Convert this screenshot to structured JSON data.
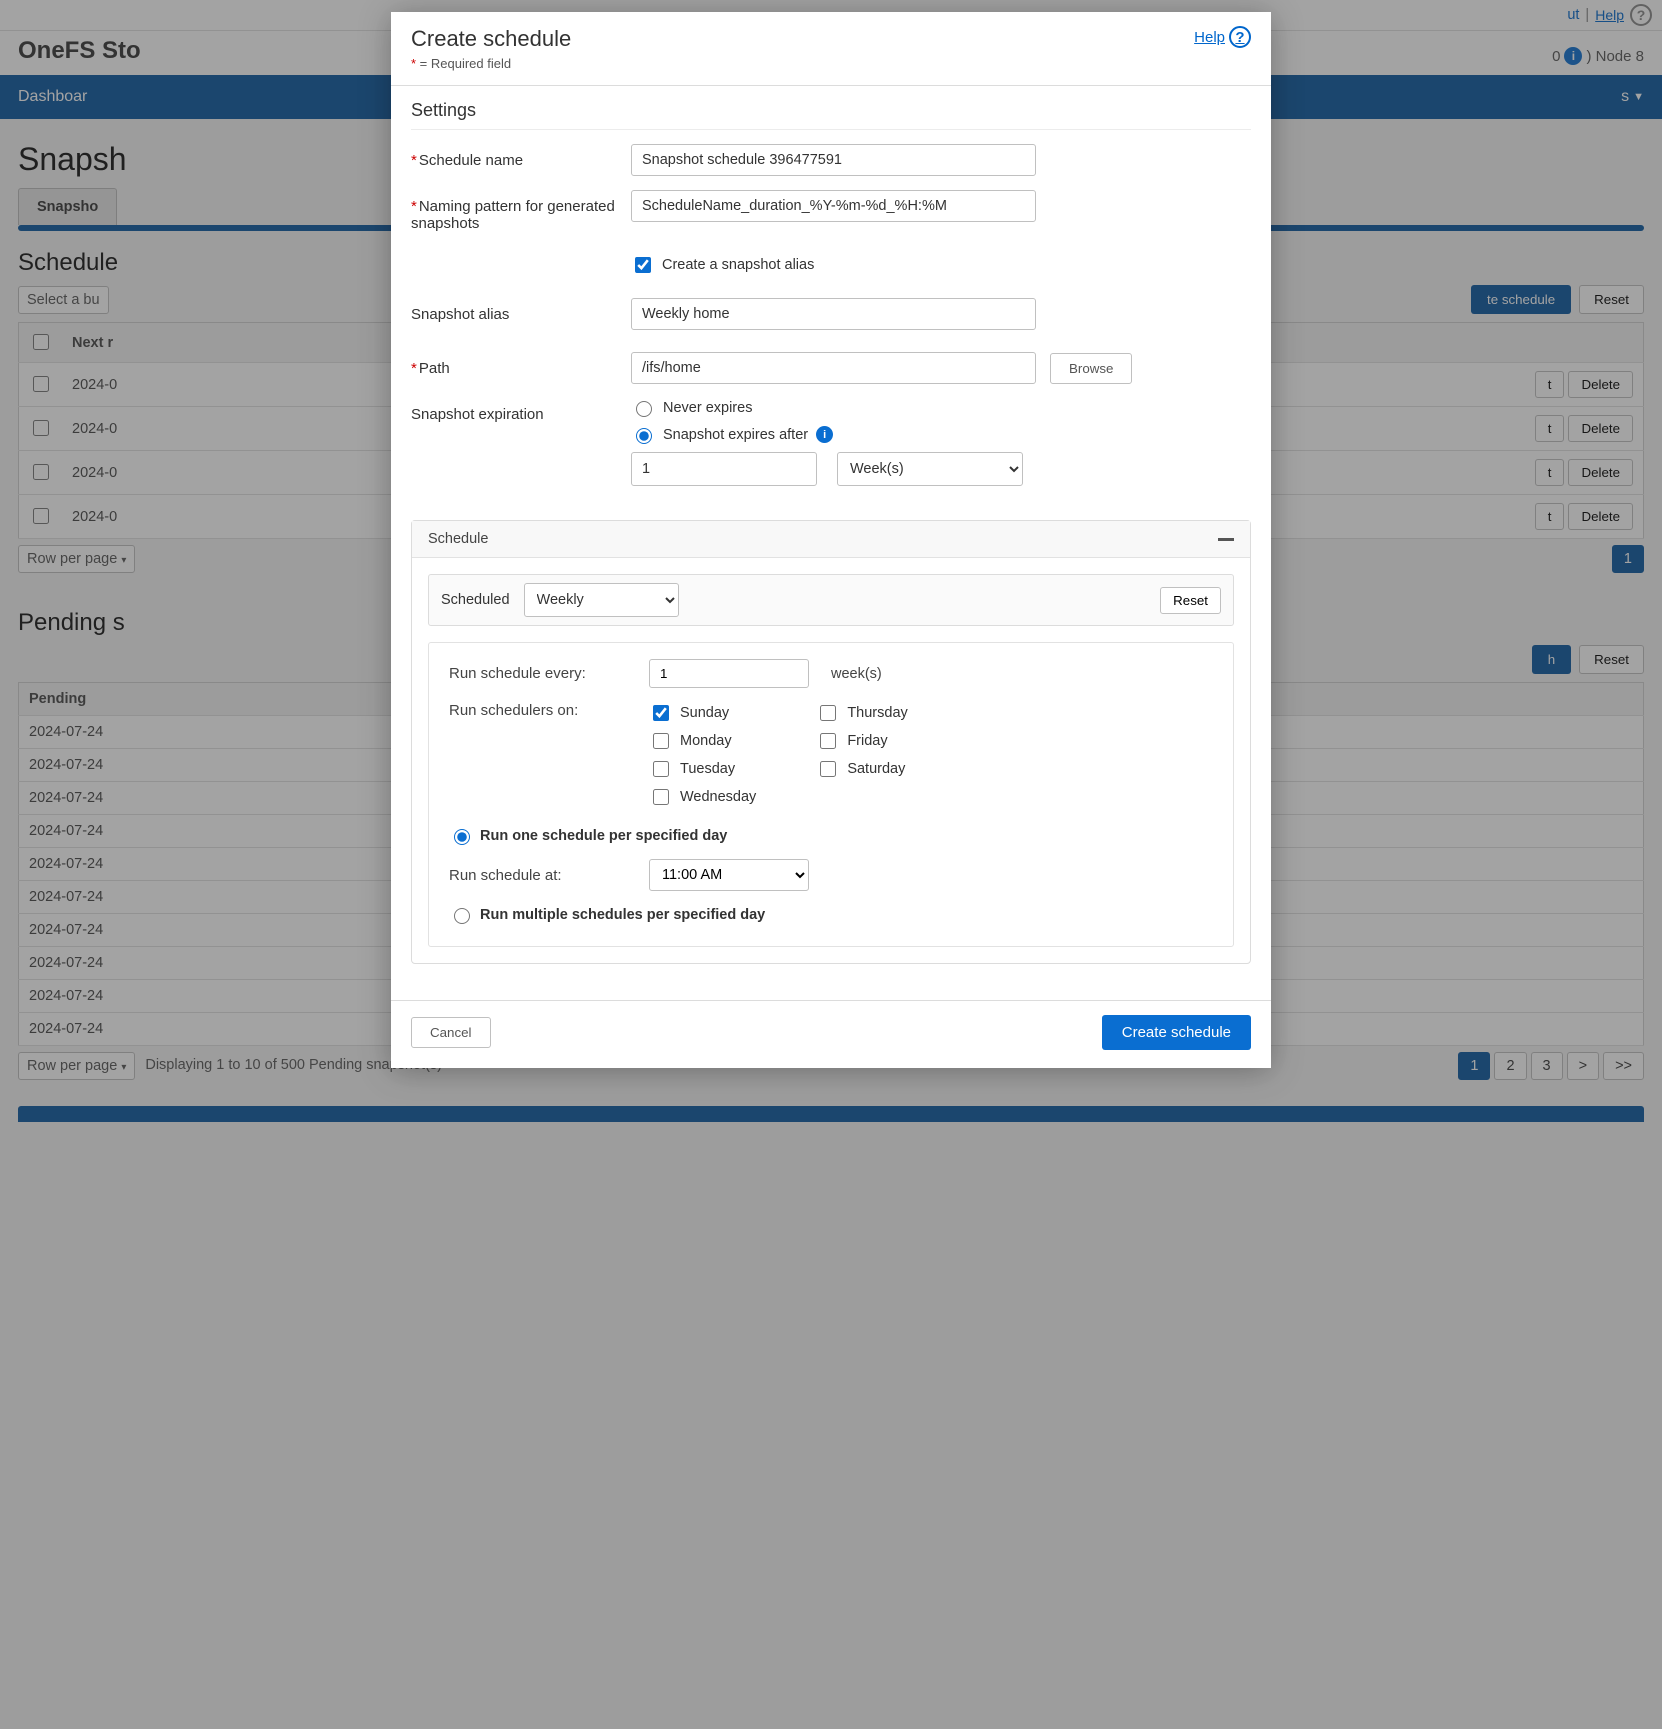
{
  "header": {
    "help_link": "Help",
    "out_label": "ut",
    "brand": "OneFS Sto",
    "node_info_left": "0",
    "node_info_right": ") Node 8",
    "nav_left": "Dashboar",
    "nav_right_caret": "s"
  },
  "page": {
    "title": "Snapsh",
    "tab": "Snapsho",
    "schedules_hdr": "Schedule",
    "bulk_placeholder": "Select a bu",
    "create_btn": "te schedule",
    "reset_btn": "Reset",
    "col_checkbox": "",
    "col_next": "Next r",
    "schedule_cells": [
      "2024-0",
      "2024-0",
      "2024-0",
      "2024-0"
    ],
    "row_edit_btn": "t",
    "row_delete_btn": "Delete",
    "row_per_page": "Row per page",
    "pager1": "1",
    "pending_hdr": "Pending s",
    "pending_refresh": "h",
    "pending_header": "Pending",
    "pending_cells": [
      "2024-07-24",
      "2024-07-24",
      "2024-07-24",
      "2024-07-24",
      "2024-07-24",
      "2024-07-24",
      "2024-07-24",
      "2024-07-24",
      "2024-07-24",
      "2024-07-24"
    ],
    "pending_display": "Displaying 1 to 10 of 500 Pending snapshot(s)",
    "pager_pages": [
      "1",
      "2",
      "3",
      ">",
      ">>"
    ]
  },
  "modal": {
    "title": "Create schedule",
    "required_note": " = Required field",
    "help": "Help",
    "section_settings": "Settings",
    "schedule_name_label": "Schedule name",
    "schedule_name_value": "Snapshot schedule 396477591",
    "naming_pattern_label": "Naming pattern for generated snapshots",
    "naming_pattern_value": "ScheduleName_duration_%Y-%m-%d_%H:%M",
    "create_alias_label": "Create a snapshot alias",
    "snapshot_alias_label": "Snapshot alias",
    "snapshot_alias_value": "Weekly home",
    "path_label": "Path",
    "path_value": "/ifs/home",
    "browse_btn": "Browse",
    "expiration_label": "Snapshot expiration",
    "never_expires_label": "Never expires",
    "expires_after_label": "Snapshot expires after",
    "expires_value": "1",
    "expires_unit": "Week(s)",
    "sched": {
      "panel_title": "Schedule",
      "scheduled_label": "Scheduled",
      "scheduled_value": "Weekly",
      "reset_btn": "Reset",
      "run_every_label": "Run schedule every:",
      "run_every_value": "1",
      "run_every_unit": "week(s)",
      "run_on_label": "Run schedulers on:",
      "days_col1": [
        "Sunday",
        "Monday",
        "Tuesday",
        "Wednesday"
      ],
      "days_col2": [
        "Thursday",
        "Friday",
        "Saturday"
      ],
      "run_one_label": "Run one schedule per specified day",
      "run_at_label": "Run schedule at:",
      "run_at_value": "11:00 AM",
      "run_multi_label": "Run multiple schedules per specified day"
    },
    "cancel_btn": "Cancel",
    "create_btn": "Create schedule"
  }
}
